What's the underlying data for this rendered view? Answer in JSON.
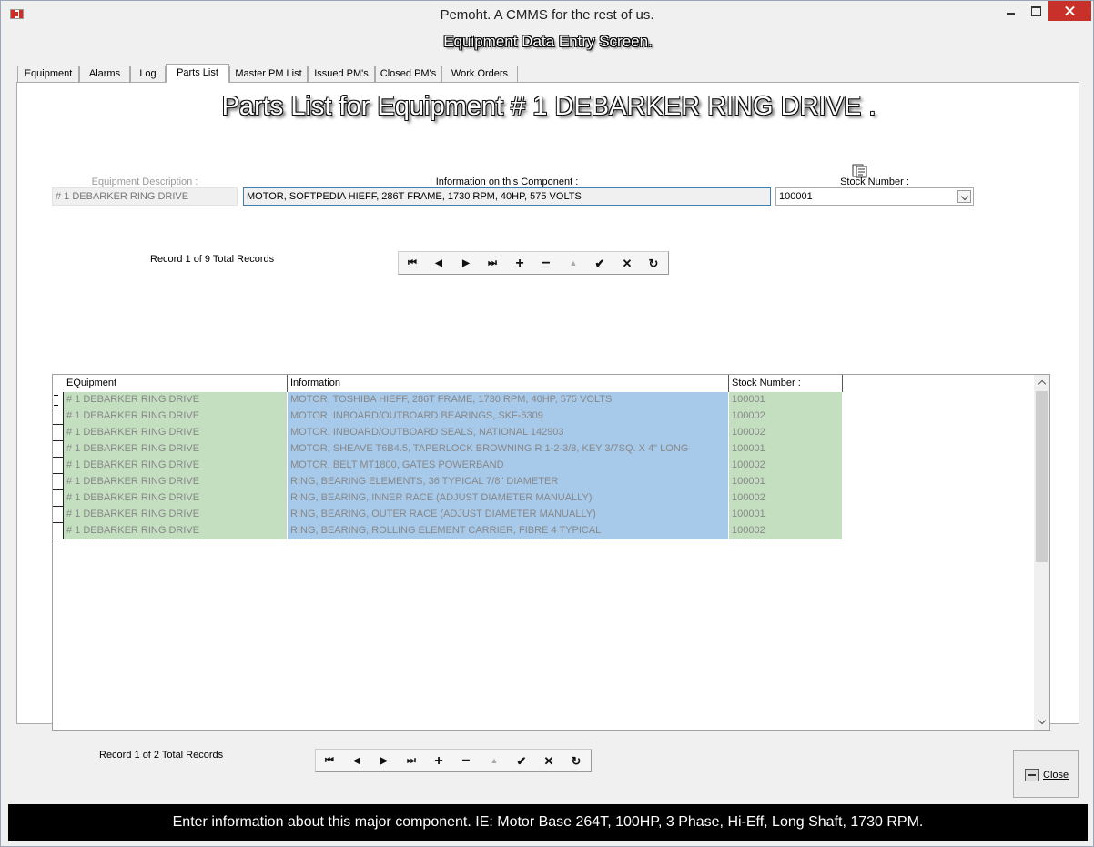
{
  "window": {
    "title": "Pemoht.  A CMMS for the rest of us.",
    "screen_title": "Equipment Data Entry Screen."
  },
  "tabs": [
    {
      "label": "Equipment"
    },
    {
      "label": "Alarms"
    },
    {
      "label": "Log"
    },
    {
      "label": "Parts List"
    },
    {
      "label": "Master PM List"
    },
    {
      "label": "Issued PM's"
    },
    {
      "label": "Closed PM's"
    },
    {
      "label": "Work Orders"
    }
  ],
  "parts": {
    "title": "Parts List for Equipment # 1 DEBARKER RING DRIVE .",
    "equipment_description_label": "Equipment Description :",
    "equipment_description_value": "# 1 DEBARKER RING DRIVE",
    "information_label": "Information on this Component :",
    "information_value": "MOTOR, SOFTPEDIA HIEFF, 286T FRAME, 1730 RPM, 40HP, 575 VOLTS",
    "stock_number_label": "Stock Number :",
    "stock_number_value": "100001",
    "record_label": "Record 1 of 9 Total Records"
  },
  "nav_icons": {
    "first": "⏮",
    "prev": "◀",
    "next": "▶",
    "last": "⏭",
    "add": "+",
    "delete": "−",
    "edit": "▲",
    "post": "✔",
    "cancel": "✕",
    "refresh": "↻"
  },
  "grid": {
    "headers": [
      "EQuipment",
      "Information",
      "Stock Number :"
    ],
    "rows": [
      [
        "# 1 DEBARKER RING DRIVE",
        "MOTOR, TOSHIBA HIEFF, 286T FRAME, 1730 RPM, 40HP, 575 VOLTS",
        "100001"
      ],
      [
        "# 1 DEBARKER RING DRIVE",
        "MOTOR, INBOARD/OUTBOARD BEARINGS, SKF-6309",
        "100002"
      ],
      [
        "# 1 DEBARKER RING DRIVE",
        "MOTOR, INBOARD/OUTBOARD SEALS, NATIONAL 142903",
        "100002"
      ],
      [
        "# 1 DEBARKER RING DRIVE",
        "MOTOR, SHEAVE T6B4.5, TAPERLOCK BROWNING R 1-2-3/8, KEY 3/7SQ. X 4\" LONG",
        "100001"
      ],
      [
        "# 1 DEBARKER RING DRIVE",
        "MOTOR, BELT MT1800, GATES POWERBAND",
        "100002"
      ],
      [
        "# 1 DEBARKER RING DRIVE",
        "RING, BEARING ELEMENTS, 36 TYPICAL 7/8\" DIAMETER",
        "100001"
      ],
      [
        "# 1 DEBARKER RING DRIVE",
        "RING, BEARING, INNER RACE (ADJUST DIAMETER MANUALLY)",
        "100002"
      ],
      [
        "# 1 DEBARKER RING DRIVE",
        "RING, BEARING, OUTER RACE (ADJUST DIAMETER MANUALLY)",
        "100001"
      ],
      [
        "# 1 DEBARKER RING DRIVE",
        "RING, BEARING, ROLLING ELEMENT CARRIER, FIBRE 4 TYPICAL",
        "100002"
      ]
    ]
  },
  "footer": {
    "record_label": "Record 1 of 2 Total Records",
    "close_label": "Close",
    "status_text": "Enter information about this major component.  IE: Motor Base 264T, 100HP, 3 Phase, Hi-Eff, Long Shaft, 1730 RPM."
  },
  "colors": {
    "equipment_cell": "#c3dfc0",
    "information_cell": "#a7c9ea",
    "status_bar": "#000000"
  }
}
